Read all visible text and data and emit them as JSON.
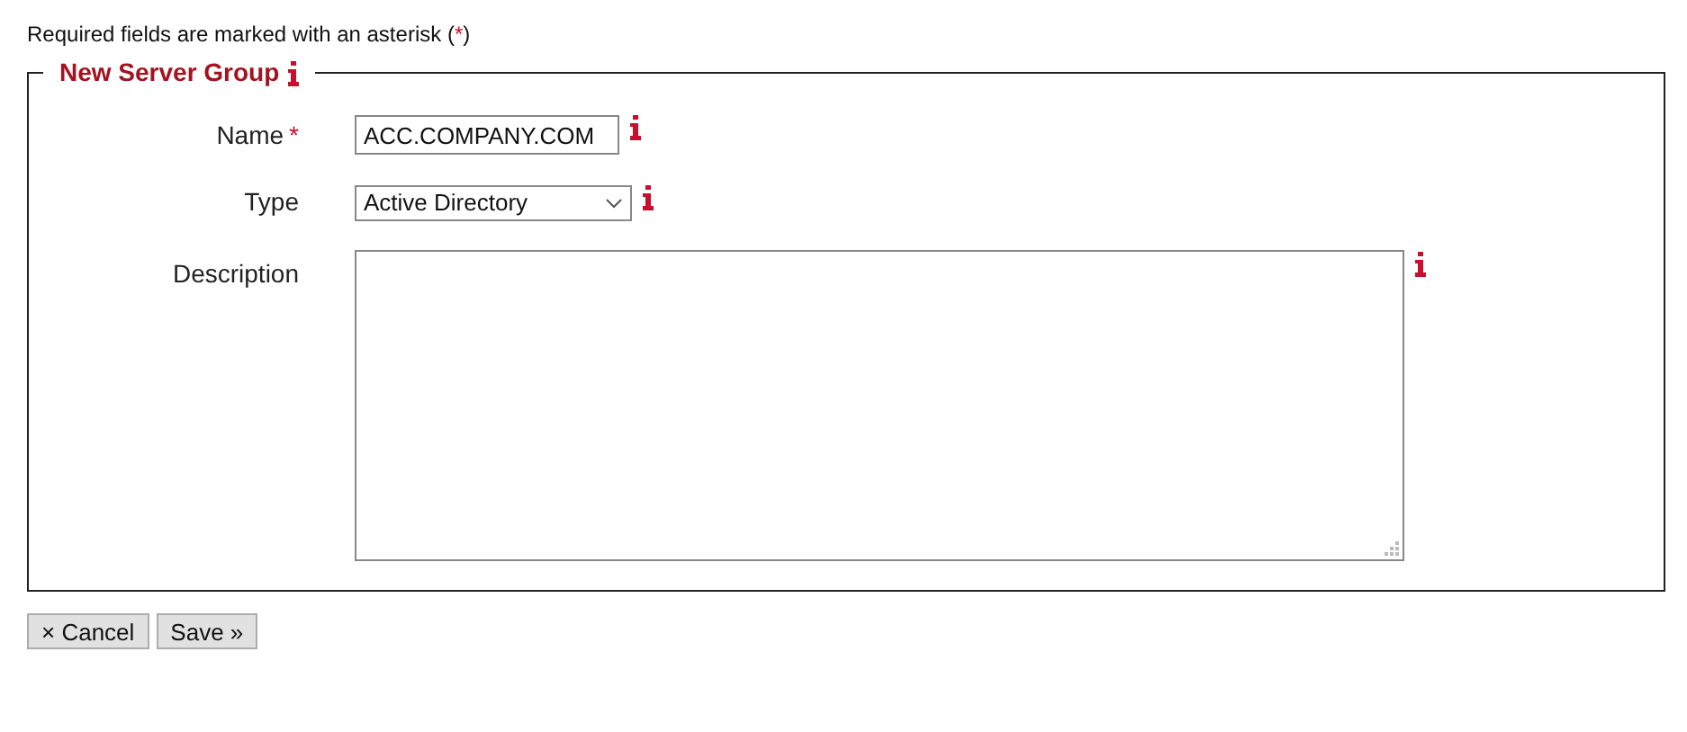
{
  "note": {
    "text": "Required fields are marked with an asterisk (",
    "marker": "*",
    "close": ")"
  },
  "group": {
    "title": "New Server Group",
    "fields": [
      {
        "kind": "text",
        "label": "Name",
        "required": true,
        "value": "ACC.COMPANY.COM"
      },
      {
        "kind": "select",
        "label": "Type",
        "required": false,
        "value": "Active Directory"
      },
      {
        "kind": "textarea",
        "label": "Description",
        "required": false
      }
    ]
  },
  "buttons": [
    {
      "label": "× Cancel"
    },
    {
      "label": "Save »"
    }
  ]
}
